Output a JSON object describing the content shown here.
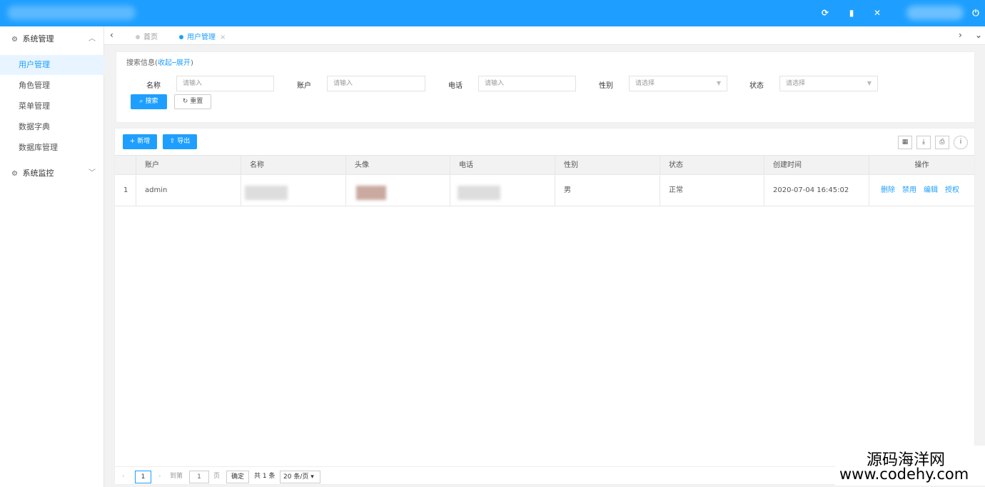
{
  "topbar": {
    "icons": [
      "refresh-icon",
      "trash-icon",
      "fullscreen-icon",
      "power-icon"
    ]
  },
  "sidebar": {
    "groups": [
      {
        "label": "系统管理",
        "icon": "gear-icon",
        "arrow": "^"
      },
      {
        "label": "系统监控",
        "icon": "gears-icon",
        "arrow": "v"
      }
    ],
    "items": [
      {
        "label": "用户管理"
      },
      {
        "label": "角色管理"
      },
      {
        "label": "菜单管理"
      },
      {
        "label": "数据字典"
      },
      {
        "label": "数据库管理"
      }
    ]
  },
  "tabs": [
    {
      "label": "首页"
    },
    {
      "label": "用户管理",
      "close": "×"
    }
  ],
  "search": {
    "title": "搜索信息(",
    "toggle": "收起─展开",
    "title_end": ")",
    "fields": [
      {
        "label": "名称",
        "placeholder": "请输入"
      },
      {
        "label": "账户",
        "placeholder": "请输入"
      },
      {
        "label": "电话",
        "placeholder": "请输入"
      },
      {
        "label": "性别",
        "placeholder": "请选择"
      },
      {
        "label": "状态",
        "placeholder": "请选择"
      }
    ],
    "search_button": "搜索",
    "reset_button": "重置"
  },
  "toolbar": {
    "add_button": "新增",
    "export_button": "导出"
  },
  "table": {
    "columns": [
      "账户",
      "名称",
      "头像",
      "电话",
      "性别",
      "状态",
      "创建时间",
      "操作"
    ],
    "rows": [
      {
        "index": "1",
        "account": "admin",
        "gender": "男",
        "status": "正常",
        "created": "2020-07-04 16:45:02",
        "actions": [
          "删除",
          "禁用",
          "编辑",
          "授权"
        ]
      }
    ]
  },
  "pager": {
    "current": "1",
    "goto_label": "到第",
    "goto_value": "1",
    "page_unit": "页",
    "confirm": "确定",
    "total": "共 1 条",
    "page_size": "20 条/页"
  },
  "watermark": {
    "line1": "源码海洋网",
    "line2": "www.codehy.com"
  }
}
